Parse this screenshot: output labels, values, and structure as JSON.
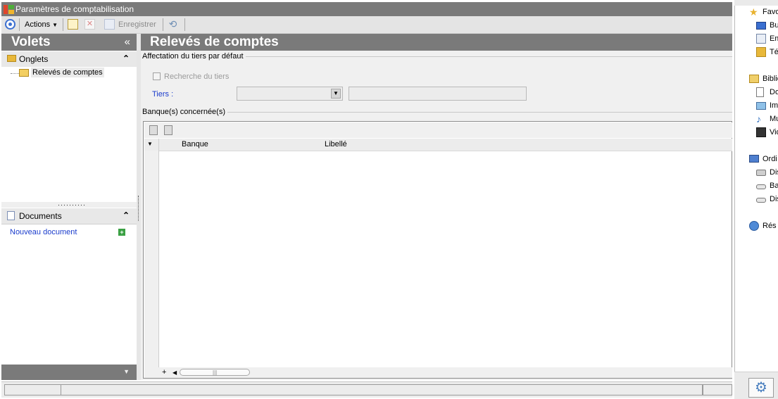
{
  "window": {
    "title": "Paramètres de comptabilisation"
  },
  "toolbar": {
    "actions_label": "Actions",
    "save_label": "Enregistrer"
  },
  "left_panel": {
    "title": "Volets",
    "collapse_glyph": "«",
    "tabs_section": {
      "label": "Onglets",
      "toggle_glyph": "⌃"
    },
    "tree": {
      "selected_item": "Relevés de comptes"
    },
    "documents_section": {
      "label": "Documents",
      "toggle_glyph": "⌃",
      "new_document_label": "Nouveau document"
    }
  },
  "main": {
    "title": "Relevés de comptes",
    "group_tiers": {
      "title": "Affectation du tiers par défaut",
      "search_checkbox_label": "Recherche du tiers",
      "search_checked": false,
      "tiers_label": "Tiers :",
      "tiers_select_value": "",
      "tiers_text_value": ""
    },
    "group_banks": {
      "title": "Banque(s) concernée(s)",
      "columns": [
        "Banque",
        "Libellé"
      ],
      "rows": []
    }
  },
  "nav_panel": {
    "items": [
      {
        "label": "Favo",
        "icon": "star-icon"
      },
      {
        "label": "Bu",
        "icon": "desktop-icon"
      },
      {
        "label": "Em",
        "icon": "places-icon"
      },
      {
        "label": "Té",
        "icon": "downloads-icon"
      },
      {
        "label": "Biblio",
        "icon": "library-icon"
      },
      {
        "label": "Do",
        "icon": "document-icon"
      },
      {
        "label": "Im",
        "icon": "image-icon"
      },
      {
        "label": "Mu",
        "icon": "music-icon"
      },
      {
        "label": "Vid",
        "icon": "video-icon"
      },
      {
        "label": "Ordi",
        "icon": "computer-icon"
      },
      {
        "label": "Dis",
        "icon": "drive-icon"
      },
      {
        "label": "Ba",
        "icon": "drive-icon"
      },
      {
        "label": "Dis",
        "icon": "drive-icon"
      },
      {
        "label": "Rés",
        "icon": "network-icon"
      }
    ]
  },
  "colors": {
    "header_gray": "#7a7a7a",
    "link_blue": "#1a3ccc",
    "folder_yellow": "#e8b83a"
  }
}
